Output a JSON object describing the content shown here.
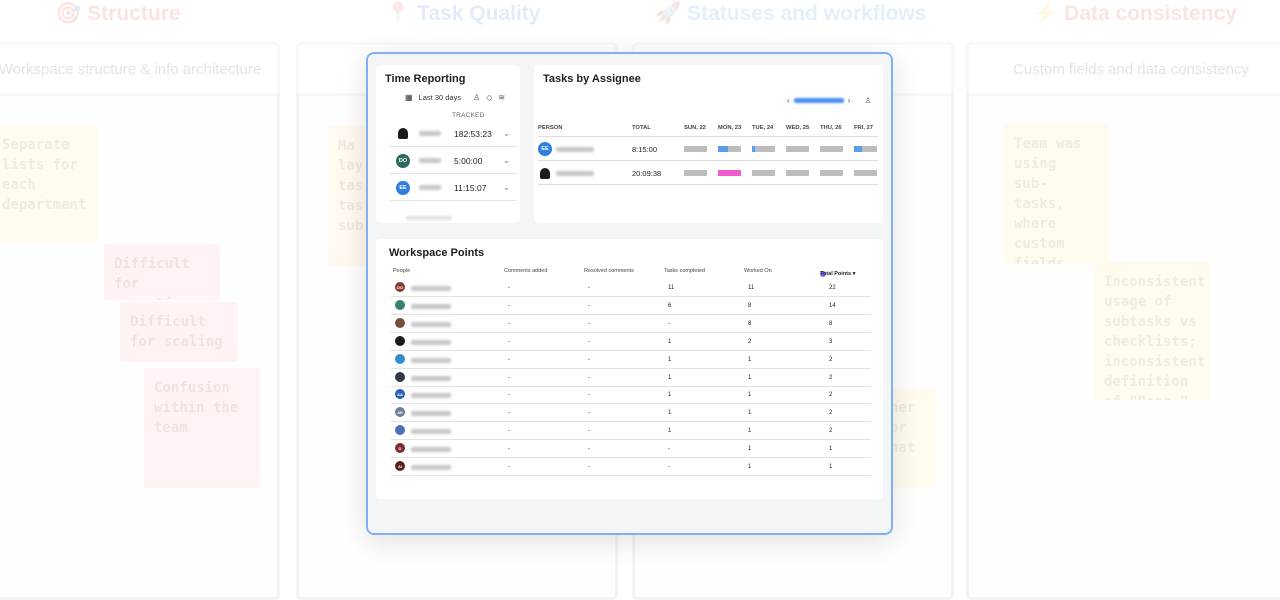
{
  "board": {
    "columns": [
      {
        "title": "Structure",
        "icon": "🎯",
        "color": "#e0392b",
        "header": "Workspace structure & info architecture"
      },
      {
        "title": "Task Quality",
        "icon": "📍",
        "color": "#2a6fdb",
        "header": ""
      },
      {
        "title": "Statuses and workflows",
        "icon": "🚀",
        "color": "#2f8ae0",
        "header": ""
      },
      {
        "title": "Data consistency",
        "icon": "⚡",
        "color": "#e0392b",
        "header": "Custom fields and data consistency"
      }
    ],
    "stickies": [
      {
        "text": "Separate lists for each department",
        "color": "yellow"
      },
      {
        "text": "Difficult for reporting",
        "color": "red"
      },
      {
        "text": "Difficult for scaling",
        "color": "red"
      },
      {
        "text": "Confusion within the team",
        "color": "red"
      },
      {
        "text": "Ma lay tas tas sub",
        "color": "orange"
      },
      {
        "text": "Team was using sub-tasks, where custom fields would be more appropriate",
        "color": "yellow"
      },
      {
        "text": "Inconsistent usage of subtasks vs checklists; inconsistent definition of \"Done.\"",
        "color": "yellow"
      },
      {
        "text": "ner\nor\nhat",
        "color": "yellow"
      }
    ]
  },
  "time_reporting": {
    "title": "Time Reporting",
    "range_label": "Last 30 days",
    "column_label": "TRACKED",
    "rows": [
      {
        "initials": "",
        "avatar_color": "photo",
        "time": "182:53:23"
      },
      {
        "initials": "DO",
        "avatar_color": "#2e6b5e",
        "time": "5:00:00"
      },
      {
        "initials": "EE",
        "avatar_color": "#2f7fe0",
        "time": "11:15:07"
      }
    ]
  },
  "tasks_by_assignee": {
    "title": "Tasks by Assignee",
    "columns": [
      "PERSON",
      "TOTAL",
      "SUN, 22",
      "MON, 23",
      "TUE, 24",
      "WED, 25",
      "THU, 26",
      "FRI, 27"
    ],
    "rows": [
      {
        "initials": "EE",
        "avatar_color": "#2f7fe0",
        "total": "8:15:00",
        "bars": [
          {
            "fill": 0,
            "color": "#5b9bf0"
          },
          {
            "fill": 0.45,
            "color": "#5b9bf0"
          },
          {
            "fill": 0.15,
            "color": "#5b9bf0"
          },
          {
            "fill": 0,
            "color": "#5b9bf0"
          },
          {
            "fill": 0,
            "color": "#5b9bf0"
          },
          {
            "fill": 0.35,
            "color": "#5b9bf0"
          }
        ]
      },
      {
        "initials": "",
        "avatar_color": "photo",
        "total": "20:09:38",
        "bars": [
          {
            "fill": 0,
            "color": "#f25bd0"
          },
          {
            "fill": 1,
            "color": "#f25bd0"
          },
          {
            "fill": 0,
            "color": "#f25bd0"
          },
          {
            "fill": 0,
            "color": "#f25bd0"
          },
          {
            "fill": 0,
            "color": "#f25bd0"
          },
          {
            "fill": 0,
            "color": "#f25bd0"
          }
        ]
      }
    ]
  },
  "workspace_points": {
    "title": "Workspace Points",
    "columns": [
      "People",
      "Comments added",
      "Resolved comments",
      "Tasks completed",
      "Worked On",
      "Total Points ▾"
    ],
    "rows": [
      {
        "initials": "DO",
        "avatar_color": "#8a3b2e",
        "comments": "-",
        "resolved": "-",
        "completed": "11",
        "worked": "11",
        "points": "22"
      },
      {
        "initials": "",
        "avatar_color": "#3a7d6b",
        "comments": "-",
        "resolved": "-",
        "completed": "6",
        "worked": "8",
        "points": "14"
      },
      {
        "initials": "",
        "avatar_color": "#7a4a3a",
        "comments": "-",
        "resolved": "-",
        "completed": "-",
        "worked": "8",
        "points": "8"
      },
      {
        "initials": "",
        "avatar_color": "#1c1c1c",
        "comments": "-",
        "resolved": "-",
        "completed": "1",
        "worked": "2",
        "points": "3"
      },
      {
        "initials": "",
        "avatar_color": "#2f8fd0",
        "comments": "-",
        "resolved": "-",
        "completed": "1",
        "worked": "1",
        "points": "2"
      },
      {
        "initials": "",
        "avatar_color": "#333a4a",
        "comments": "-",
        "resolved": "-",
        "completed": "1",
        "worked": "1",
        "points": "2"
      },
      {
        "initials": "AA",
        "avatar_color": "#2a5fb5",
        "comments": "-",
        "resolved": "-",
        "completed": "1",
        "worked": "1",
        "points": "2"
      },
      {
        "initials": "AE",
        "avatar_color": "#6b7f99",
        "comments": "-",
        "resolved": "-",
        "completed": "1",
        "worked": "1",
        "points": "2"
      },
      {
        "initials": "",
        "avatar_color": "#4a6fb5",
        "comments": "-",
        "resolved": "-",
        "completed": "1",
        "worked": "1",
        "points": "2"
      },
      {
        "initials": "D",
        "avatar_color": "#7a2e2e",
        "comments": "-",
        "resolved": "-",
        "completed": "-",
        "worked": "1",
        "points": "1"
      },
      {
        "initials": "AI",
        "avatar_color": "#5a2020",
        "comments": "-",
        "resolved": "-",
        "completed": "-",
        "worked": "1",
        "points": "1"
      }
    ]
  }
}
